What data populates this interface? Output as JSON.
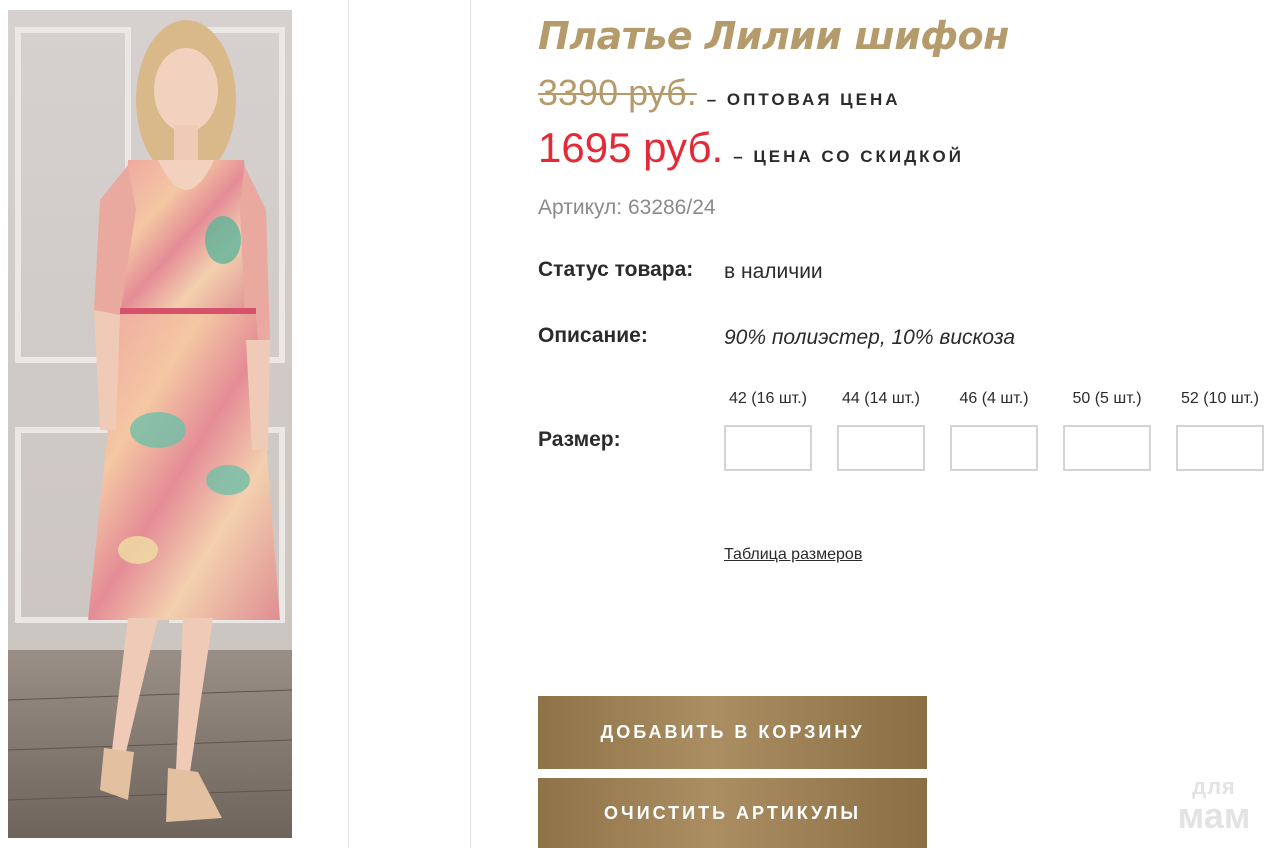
{
  "product": {
    "title": "Платье Лилии шифон",
    "wholesale_price": "3390 руб.",
    "wholesale_note": "– ОПТОВАЯ ЦЕНА",
    "sale_price": "1695 руб.",
    "sale_note": "– ЦЕНА СО СКИДКОЙ",
    "article": "Артикул: 63286/24"
  },
  "details": {
    "status_label": "Статус товара:",
    "status_value": "в наличии",
    "description_label": "Описание:",
    "description_value": "90% полиэстер, 10% вискоза",
    "size_label": "Размер:"
  },
  "sizes": [
    {
      "label": "42 (16 шт.)",
      "value": ""
    },
    {
      "label": "44 (14 шт.)",
      "value": ""
    },
    {
      "label": "46 (4 шт.)",
      "value": ""
    },
    {
      "label": "50 (5 шт.)",
      "value": ""
    },
    {
      "label": "52 (10 шт.)",
      "value": ""
    }
  ],
  "size_table_link": "Таблица размеров",
  "buttons": {
    "add_to_cart": "ДОБАВИТЬ В КОРЗИНУ",
    "clear_articles": "ОЧИСТИТЬ АРТИКУЛЫ"
  },
  "watermark": {
    "top": "для",
    "bottom": "мам"
  },
  "colors": {
    "accent_gold": "#b59b6b",
    "sale_red": "#e32a36",
    "button_bronze": "#9c7f54"
  }
}
